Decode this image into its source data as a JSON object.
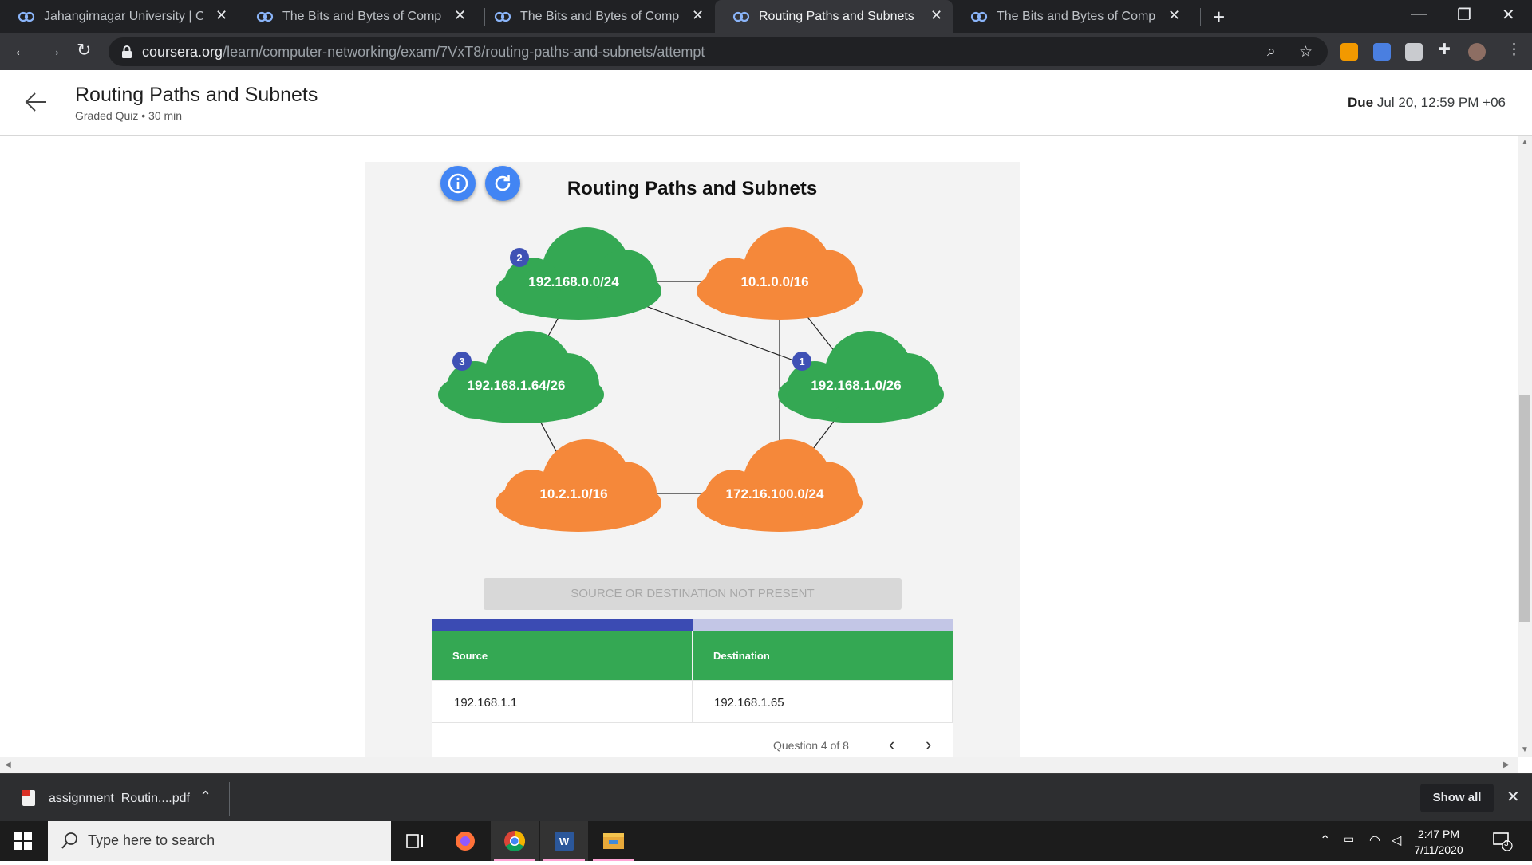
{
  "browser": {
    "tabs": [
      {
        "title": "Jahangirnagar University | Course",
        "active": false
      },
      {
        "title": "The Bits and Bytes of Computer N",
        "active": false
      },
      {
        "title": "The Bits and Bytes of Computer N",
        "active": false
      },
      {
        "title": "Routing Paths and Subnets | Cou",
        "active": true
      },
      {
        "title": "The Bits and Bytes of Computer N",
        "active": false
      }
    ],
    "url_host": "coursera.org",
    "url_path": "/learn/computer-networking/exam/7VxT8/routing-paths-and-subnets/attempt"
  },
  "header": {
    "title": "Routing Paths and Subnets",
    "meta": "Graded Quiz • 30 min",
    "due_label": "Due",
    "due_value": "Jul 20, 12:59 PM +06"
  },
  "diagram": {
    "title": "Routing Paths and Subnets",
    "colors": {
      "green": "#34a853",
      "orange": "#f5883a",
      "badge": "#3f51b5",
      "button": "#4285f4"
    },
    "networks": [
      {
        "id": "n1",
        "label": "192.168.0.0/24",
        "color": "green",
        "badge": "2"
      },
      {
        "id": "n2",
        "label": "10.1.0.0/16",
        "color": "orange",
        "badge": ""
      },
      {
        "id": "n3",
        "label": "192.168.1.64/26",
        "color": "green",
        "badge": "3"
      },
      {
        "id": "n4",
        "label": "192.168.1.0/26",
        "color": "green",
        "badge": "1"
      },
      {
        "id": "n5",
        "label": "10.2.1.0/16",
        "color": "orange",
        "badge": ""
      },
      {
        "id": "n6",
        "label": "172.16.100.0/24",
        "color": "orange",
        "badge": ""
      }
    ],
    "links": [
      [
        "n1",
        "n2"
      ],
      [
        "n1",
        "n3"
      ],
      [
        "n1",
        "n4"
      ],
      [
        "n2",
        "n4"
      ],
      [
        "n2",
        "n6"
      ],
      [
        "n3",
        "n5"
      ],
      [
        "n5",
        "n6"
      ],
      [
        "n4",
        "n6"
      ]
    ],
    "status": "SOURCE OR DESTINATION NOT PRESENT",
    "progress": 0.5
  },
  "table": {
    "headers": [
      "Source",
      "Destination"
    ],
    "row": [
      "192.168.1.1",
      "192.168.1.65"
    ]
  },
  "footer": {
    "question": "Question 4 of 8"
  },
  "download": {
    "file": "assignment_Routin....pdf",
    "show_all": "Show all"
  },
  "taskbar": {
    "search": "Type here to search",
    "time": "2:47 PM",
    "date": "7/11/2020",
    "notifications": "3"
  }
}
